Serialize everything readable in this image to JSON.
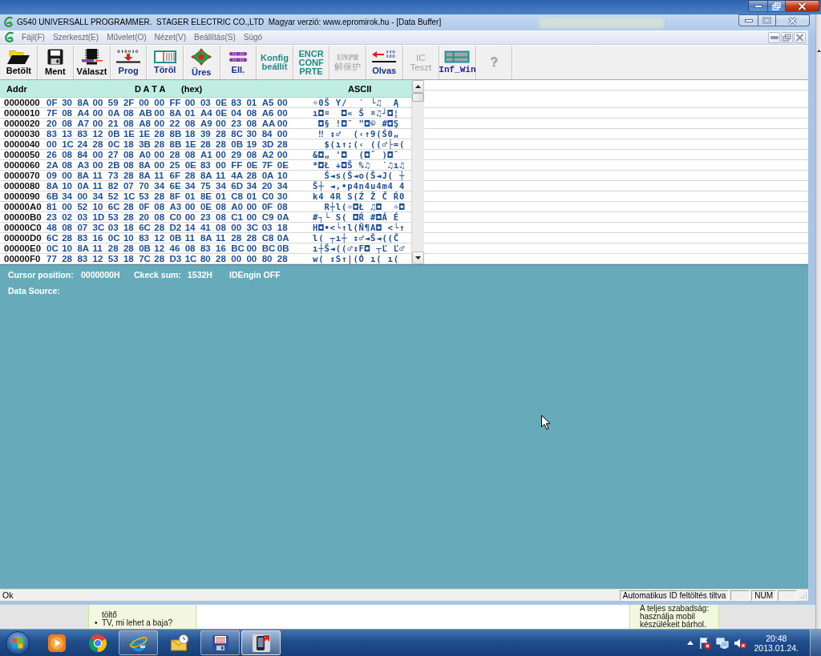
{
  "window": {
    "title": "G540 UNIVERSALL PROGRAMMER.  STAGER ELECTRIC CO.,LTD  Magyar verzió: www.epromirok.hu - [Data Buffer]"
  },
  "menu": [
    "Fájl(F)",
    "Szerkeszt(E)",
    "Művelet(O)",
    "Nézet(V)",
    "Beállítás(S)",
    "Súgó"
  ],
  "toolbar": [
    {
      "kind": "folder",
      "lines": [
        "Betölt"
      ],
      "disabled": false
    },
    {
      "kind": "floppy",
      "lines": [
        "Ment"
      ],
      "disabled": false
    },
    {
      "kind": "chip",
      "lines": [
        "Választ"
      ],
      "disabled": false
    },
    {
      "kind": "prog",
      "lines": [
        "Prog"
      ],
      "disabled": false
    },
    {
      "kind": "erase",
      "lines": [
        "Töröl"
      ],
      "disabled": false
    },
    {
      "kind": "blank",
      "lines": [
        "Üres"
      ],
      "disabled": false
    },
    {
      "kind": "check",
      "lines": [
        "Ell."
      ],
      "disabled": false
    },
    {
      "kind": "text",
      "lines": [
        "Konfig",
        "beállít"
      ],
      "disabled": false
    },
    {
      "kind": "text",
      "lines": [
        "ENCR",
        "CONF",
        "PRTE"
      ],
      "disabled": false
    },
    {
      "kind": "logo",
      "lines": [
        "UNPR",
        "解保护"
      ],
      "disabled": true
    },
    {
      "kind": "read",
      "lines": [
        "Olvas"
      ],
      "disabled": false
    },
    {
      "kind": "text",
      "lines": [
        "IC",
        "Teszt"
      ],
      "disabled": true
    },
    {
      "kind": "window",
      "lines": [
        "Inf_Win"
      ],
      "disabled": false
    },
    {
      "kind": "glyph",
      "lines": [
        "?"
      ],
      "disabled": true
    }
  ],
  "hex_view": {
    "columns": {
      "addr": "Addr",
      "data": "D A T A",
      "format": "(hex)",
      "ascii": "ASCII"
    },
    "rows": [
      {
        "addr": "0000000",
        "bytes": [
          "0F",
          "30",
          "8A",
          "00",
          "59",
          "2F",
          "00",
          "00",
          "FF",
          "00",
          "03",
          "0E",
          "83",
          "01",
          "A5",
          "00"
        ],
        "ascii": "☼0Š Y/  ˙ └♫  Ą"
      },
      {
        "addr": "0000010",
        "bytes": [
          "7F",
          "08",
          "A4",
          "00",
          "0A",
          "08",
          "AB",
          "00",
          "8A",
          "01",
          "A4",
          "0E",
          "04",
          "08",
          "A6",
          "00"
        ],
        "ascii": "ı◘¤  ◘« Š ¤♫┘◘¦"
      },
      {
        "addr": "0000020",
        "bytes": [
          "20",
          "08",
          "A7",
          "00",
          "21",
          "08",
          "A8",
          "00",
          "22",
          "08",
          "A9",
          "00",
          "23",
          "08",
          "AA",
          "00"
        ],
        "ascii": " ◘§ !◘¨ \"◘© #◘Ş"
      },
      {
        "addr": "0000030",
        "bytes": [
          "83",
          "13",
          "83",
          "12",
          "0B",
          "1E",
          "1E",
          "28",
          "8B",
          "18",
          "39",
          "28",
          "8C",
          "30",
          "84",
          "00"
        ],
        "ascii": " ‼ ↕♂  (‹↑9(Ś0„"
      },
      {
        "addr": "0000040",
        "bytes": [
          "00",
          "1C",
          "24",
          "28",
          "0C",
          "18",
          "3B",
          "28",
          "8B",
          "1E",
          "28",
          "28",
          "0B",
          "19",
          "3D",
          "28"
        ],
        "ascii": "  $(ı↑;(‹ ((♂├=("
      },
      {
        "addr": "0000050",
        "bytes": [
          "26",
          "08",
          "84",
          "00",
          "27",
          "08",
          "A0",
          "00",
          "28",
          "08",
          "A1",
          "00",
          "29",
          "08",
          "A2",
          "00"
        ],
        "ascii": "&◘„ '◘  (◘ˇ )◘˘"
      },
      {
        "addr": "0000060",
        "bytes": [
          "2A",
          "08",
          "A3",
          "00",
          "2B",
          "08",
          "8A",
          "00",
          "25",
          "0E",
          "83",
          "00",
          "FF",
          "0E",
          "7F",
          "0E"
        ],
        "ascii": "*◘Ł +◘Š %♫  ˙♫ı♫"
      },
      {
        "addr": "0000070",
        "bytes": [
          "09",
          "00",
          "8A",
          "11",
          "73",
          "28",
          "8A",
          "11",
          "6F",
          "28",
          "8A",
          "11",
          "4A",
          "28",
          "0A",
          "10"
        ],
        "ascii": "  Š◄s(Š◄o(Š◄J( ┼"
      },
      {
        "addr": "0000080",
        "bytes": [
          "8A",
          "10",
          "0A",
          "11",
          "82",
          "07",
          "70",
          "34",
          "6E",
          "34",
          "75",
          "34",
          "6D",
          "34",
          "20",
          "34"
        ],
        "ascii": "Š┼ ◄‚•p4n4u4m4 4"
      },
      {
        "addr": "0000090",
        "bytes": [
          "6B",
          "34",
          "00",
          "34",
          "52",
          "1C",
          "53",
          "28",
          "8F",
          "01",
          "8E",
          "01",
          "C8",
          "01",
          "C0",
          "30"
        ],
        "ascii": "k4 4R S(Ź Ž Č Ŕ0"
      },
      {
        "addr": "00000A0",
        "bytes": [
          "81",
          "00",
          "52",
          "10",
          "6C",
          "28",
          "0F",
          "08",
          "A3",
          "00",
          "0E",
          "08",
          "A0",
          "00",
          "0F",
          "08"
        ],
        "ascii": "  R┼l(☼◘Ł ♫◘  ☼◘"
      },
      {
        "addr": "00000B0",
        "bytes": [
          "23",
          "02",
          "03",
          "1D",
          "53",
          "28",
          "20",
          "08",
          "C0",
          "00",
          "23",
          "08",
          "C1",
          "00",
          "C9",
          "0A"
        ],
        "ascii": "#┐└ S( ◘Ŕ #◘Á É"
      },
      {
        "addr": "00000C0",
        "bytes": [
          "48",
          "08",
          "07",
          "3C",
          "03",
          "18",
          "6C",
          "28",
          "D2",
          "14",
          "41",
          "08",
          "00",
          "3C",
          "03",
          "18"
        ],
        "ascii": "H◘•<└↑l(Ň¶A◘ <└↑"
      },
      {
        "addr": "00000D0",
        "bytes": [
          "6C",
          "28",
          "83",
          "16",
          "0C",
          "10",
          "83",
          "12",
          "0B",
          "11",
          "8A",
          "11",
          "28",
          "28",
          "C8",
          "0A"
        ],
        "ascii": "l( ┬ı┼ ↕♂◄Š◄((Č"
      },
      {
        "addr": "00000E0",
        "bytes": [
          "0C",
          "10",
          "8A",
          "11",
          "28",
          "28",
          "0B",
          "12",
          "46",
          "08",
          "83",
          "16",
          "BC",
          "00",
          "BC",
          "0B"
        ],
        "ascii": "ı┼Š◄((♂↕F◘ ┬Ľ Ľ♂"
      },
      {
        "addr": "00000F0",
        "bytes": [
          "77",
          "28",
          "83",
          "12",
          "53",
          "18",
          "7C",
          "28",
          "D3",
          "1C",
          "80",
          "28",
          "00",
          "00",
          "80",
          "28"
        ],
        "ascii": "w( ↕S↑|(Ó ı( ı("
      }
    ]
  },
  "info_panel": {
    "cursor_label": "Cursor position:",
    "cursor_value": "0000000H",
    "checksum_label": "Ckeck sum:",
    "checksum_value": "1532H",
    "engine_status": "IDEngin OFF",
    "source_label": "Data Source:"
  },
  "status_bar": {
    "message": "Ok",
    "panels": [
      "Automatikus ID feltöltés tiltva",
      "NUM"
    ]
  },
  "background_page": {
    "left_box": {
      "items": [
        {
          "text": "töltő"
        },
        {
          "marker": "•",
          "text": "TV, mi lehet a baja?"
        }
      ]
    },
    "right_box": {
      "lines": [
        "A teljes szabadság:",
        "használja mobil",
        "készülékeit bárhol."
      ]
    }
  },
  "taskbar": {
    "apps": [
      {
        "kind": "play",
        "running": false,
        "selected": false
      },
      {
        "kind": "chrome",
        "running": false,
        "selected": false
      },
      {
        "kind": "ie",
        "running": true,
        "selected": false
      },
      {
        "kind": "mail",
        "running": false,
        "selected": false
      },
      {
        "kind": "floppy",
        "running": true,
        "selected": false
      },
      {
        "kind": "phone",
        "running": true,
        "selected": true
      }
    ],
    "clock": {
      "time": "20:48",
      "date": "2013.01.24."
    }
  }
}
